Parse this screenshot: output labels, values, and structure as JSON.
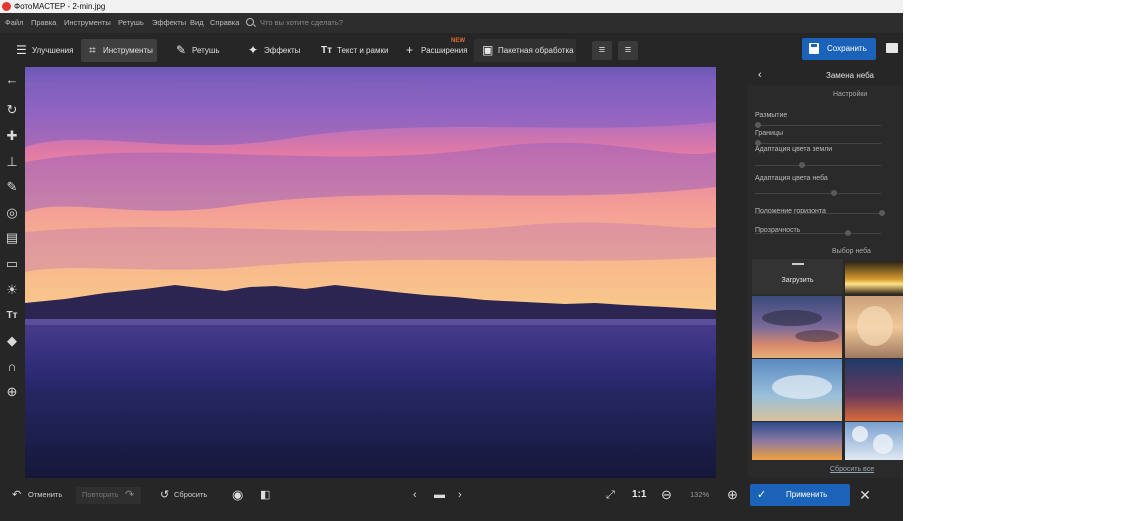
{
  "titlebar": {
    "title": "ФотоМАСТЕР - 2-min.jpg"
  },
  "menu": {
    "items": [
      "Файл",
      "Правка",
      "Инструменты",
      "Ретушь",
      "Эффекты",
      "Вид",
      "Справка"
    ],
    "search_placeholder": "Что вы хотите сделать?"
  },
  "toolbar": {
    "tabs": [
      "Улучшения",
      "Инструменты",
      "Ретушь",
      "Эффекты",
      "Текст и рамки",
      "Расширения",
      "Пакетная обработка"
    ],
    "active_tab": "Инструменты",
    "new_badge": "NEW",
    "save_label": "Сохранить"
  },
  "panel": {
    "title": "Замена неба",
    "subtitle": "Настройки",
    "sliders": [
      {
        "label": "Размытие",
        "value": 0.0
      },
      {
        "label": "Границы",
        "value": 0.0
      },
      {
        "label": "Адаптация цвета земли",
        "value": 0.35
      },
      {
        "label": "Адаптация цвета неба",
        "value": 0.6
      },
      {
        "label": "Положение горизонта",
        "value": 1.0
      },
      {
        "label": "Прозрачность",
        "value": 0.71
      }
    ],
    "sky_section": "Выбор неба",
    "upload_label": "Загрузить",
    "reset_all": "Сбросить все"
  },
  "bottom": {
    "undo": "Отменить",
    "redo": "Повторить",
    "reset": "Сбросить",
    "ratio": "1:1",
    "zoom": "132%",
    "apply": "Применить"
  },
  "colors": {
    "accent": "#1b63b8",
    "new_badge": "#e56d2a"
  }
}
